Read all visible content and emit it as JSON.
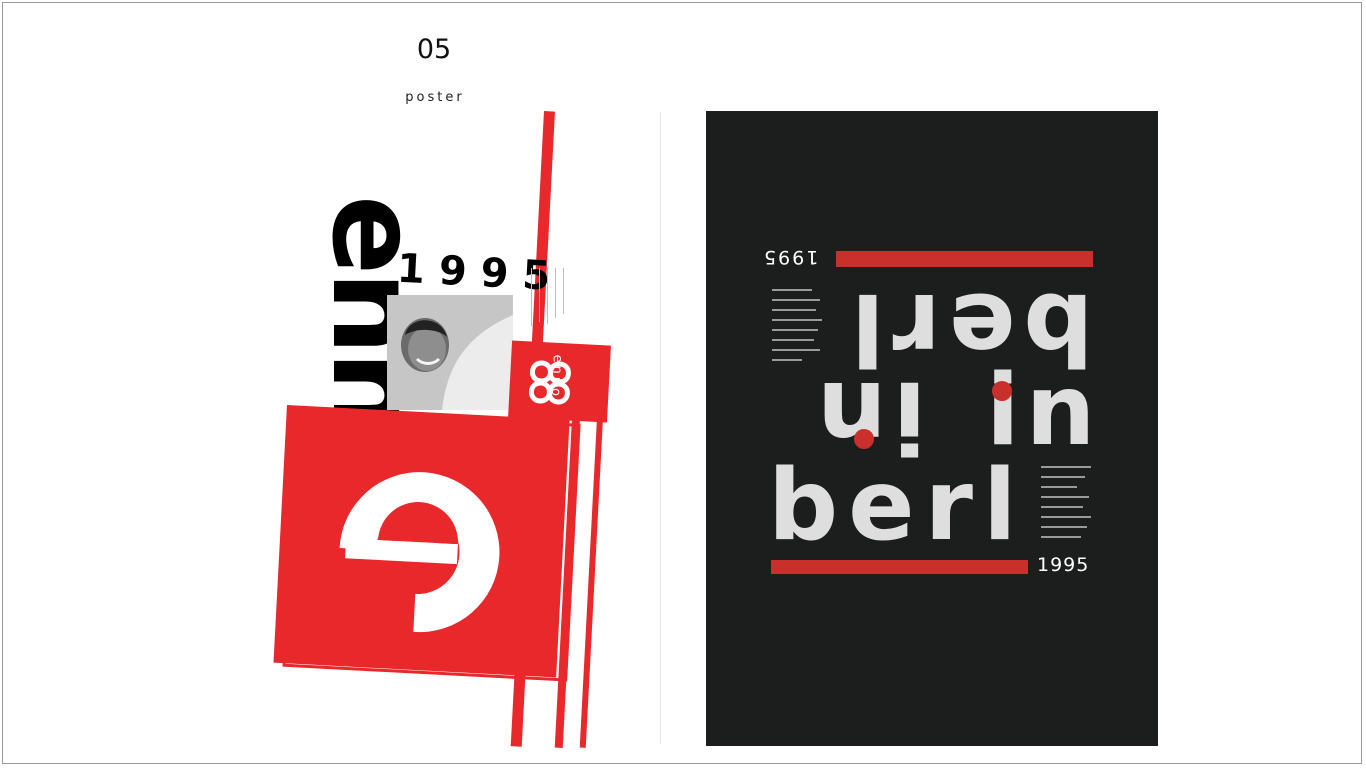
{
  "slide": {
    "number": "05",
    "label": "poster"
  },
  "left_poster": {
    "rotated_word": "enno",
    "year": "1995",
    "logo_word": "enno",
    "big_letter": "e",
    "colors": {
      "accent": "#e8282b",
      "ink": "#000000"
    }
  },
  "right_poster": {
    "year_top": "1995",
    "year_bottom": "1995",
    "word_top": "berl",
    "word_bottom": "berl",
    "word_in": "in",
    "colors": {
      "background": "#1c1d1d",
      "accent": "#c9302c",
      "type": "#dedede"
    }
  }
}
